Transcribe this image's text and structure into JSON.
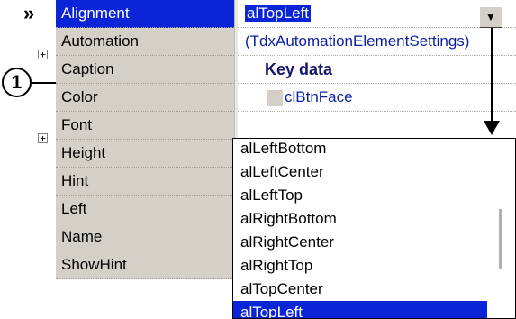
{
  "inspector": {
    "properties": [
      {
        "name": "Alignment",
        "value": "alTopLeft"
      },
      {
        "name": "Automation",
        "value": "(TdxAutomationElementSettings)"
      },
      {
        "name": "Caption",
        "value": "Key data"
      },
      {
        "name": "Color",
        "value": "clBtnFace"
      },
      {
        "name": "Font",
        "value": ""
      },
      {
        "name": "Height",
        "value": ""
      },
      {
        "name": "Hint",
        "value": ""
      },
      {
        "name": "Left",
        "value": ""
      },
      {
        "name": "Name",
        "value": ""
      },
      {
        "name": "ShowHint",
        "value": ""
      }
    ]
  },
  "callout": {
    "label": "1"
  },
  "colors": {
    "selection": "#0a24d8",
    "name_column": "#d4d0c8",
    "link_text": "#0a1fa0"
  },
  "icons": {
    "row_indicator": "double-chevron-right-icon",
    "expand": "plus-box-icon",
    "dropdown": "triangle-down-icon",
    "arrow": "down-arrow-icon"
  },
  "dropdown": {
    "options": [
      "alLeftBottom",
      "alLeftCenter",
      "alLeftTop",
      "alRightBottom",
      "alRightCenter",
      "alRightTop",
      "alTopCenter",
      "alTopLeft"
    ],
    "selected": "alTopLeft"
  }
}
